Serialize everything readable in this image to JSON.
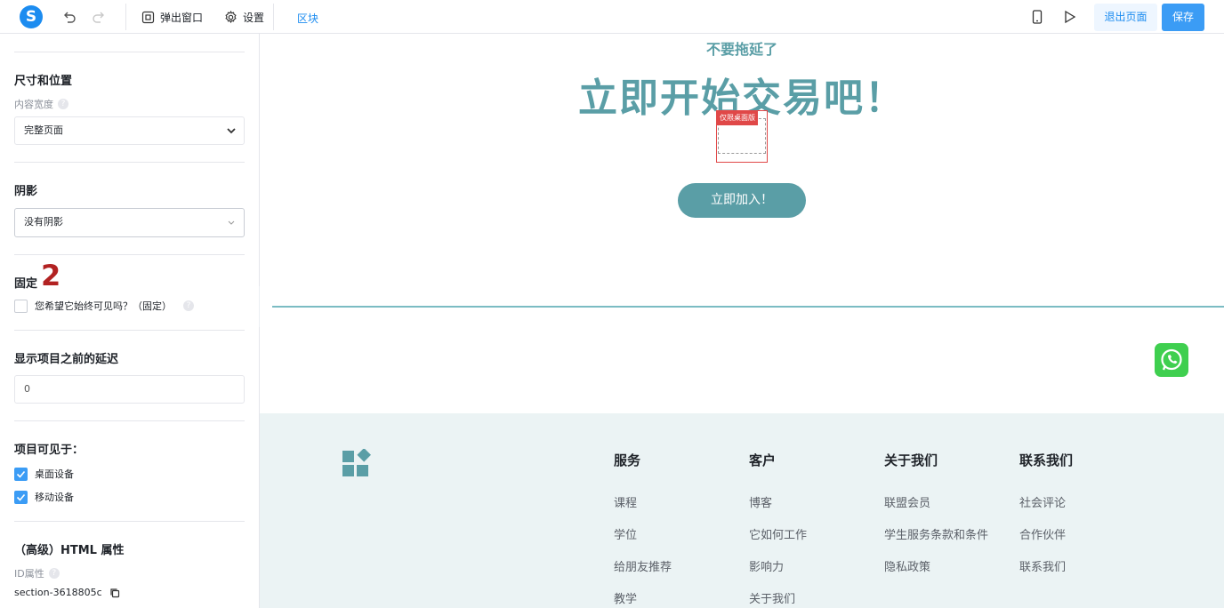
{
  "toolbar": {
    "logo_letter": "S",
    "popup_label": "弹出窗口",
    "settings_label": "设置",
    "block_tab": "区块",
    "exit_label": "退出页面",
    "save_label": "保存"
  },
  "sidebar": {
    "size_section": "尺寸和位置",
    "content_width_label": "内容宽度",
    "content_width_value": "完整页面",
    "shadow_section": "阴影",
    "shadow_value": "没有阴影",
    "fixed_section": "固定",
    "annotation_number": "2",
    "fixed_checkbox_label": "您希望它始终可见吗？（固定）",
    "delay_section": "显示项目之前的延迟",
    "delay_value": "0",
    "visible_section": "项目可见于：",
    "desktop_label": "桌面设备",
    "mobile_label": "移动设备",
    "html_section": "（高级）HTML 属性",
    "id_label": "ID属性",
    "id_value": "section-3618805c"
  },
  "canvas": {
    "subtitle": "不要拖延了",
    "headline": "立即开始交易吧！",
    "desktop_only_tag": "仅限桌面版",
    "join_button": "立即加入！"
  },
  "footer": {
    "columns": [
      {
        "title": "服务",
        "items": [
          "课程",
          "学位",
          "给朋友推荐",
          "教学"
        ]
      },
      {
        "title": "客户",
        "items": [
          "博客",
          "它如何工作",
          "影响力",
          "关于我们"
        ]
      },
      {
        "title": "关于我们",
        "items": [
          "联盟会员",
          "学生服务条款和条件",
          "隐私政策"
        ]
      },
      {
        "title": "联系我们",
        "items": [
          "社会评论",
          "合作伙伴",
          "联系我们"
        ]
      }
    ]
  },
  "colors": {
    "accent": "#1c8cf0",
    "teal": "#5a9ea6",
    "footer_bg": "#ebf3f4",
    "annotation": "#b22222",
    "whatsapp": "#3fcf4f"
  }
}
